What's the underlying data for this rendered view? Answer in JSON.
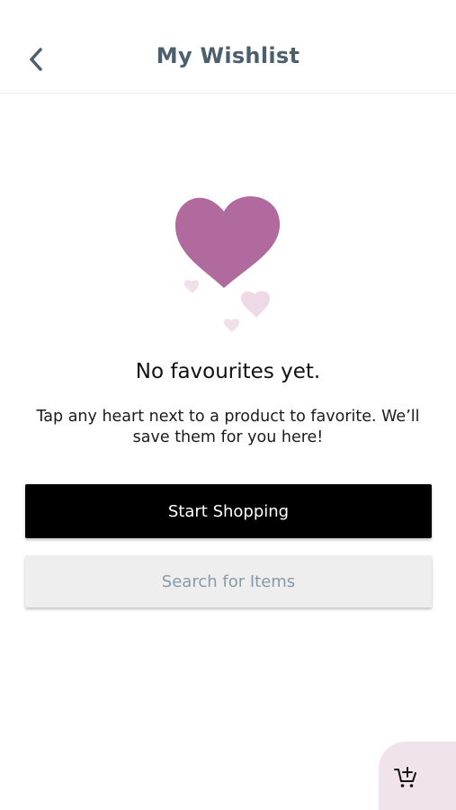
{
  "header": {
    "title": "My Wishlist",
    "back_icon": "chevron-left-icon"
  },
  "empty_state": {
    "illustration_icon": "hearts-icon",
    "title": "No favourites yet.",
    "description": "Tap any heart next to a product to favorite. We’ll save them for you here!"
  },
  "actions": {
    "primary_label": "Start Shopping",
    "secondary_label": "Search for Items"
  },
  "cart": {
    "icon": "cart-add-icon"
  },
  "colors": {
    "title": "#4c5f6d",
    "heart_main": "#b06a9e",
    "heart_light": "#eed9e6",
    "primary_button": "#000000",
    "secondary_button": "#eeeeee",
    "secondary_text": "#8a9aa4",
    "cart_fab": "#f1e3ec"
  }
}
